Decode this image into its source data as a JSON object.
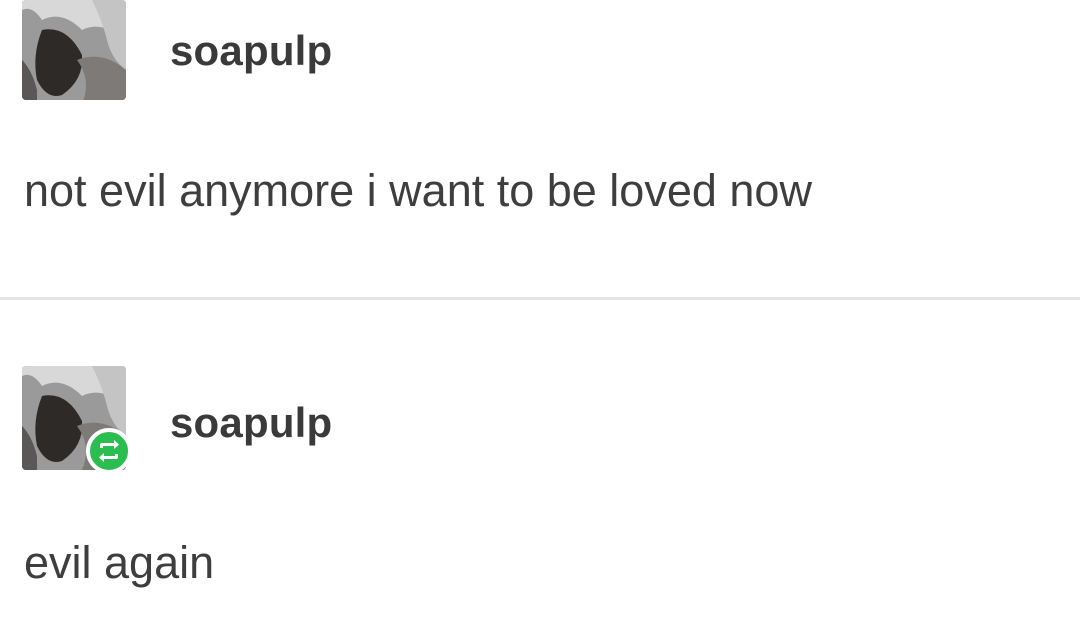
{
  "posts": [
    {
      "username": "soapulp",
      "text": "not evil anymore i want to be loved now",
      "reblogged": false
    },
    {
      "username": "soapulp",
      "text": "evil again",
      "reblogged": true
    }
  ],
  "colors": {
    "reblog_badge": "#2bbd4f",
    "text": "#3e3e3e",
    "divider": "#e4e4e4"
  }
}
